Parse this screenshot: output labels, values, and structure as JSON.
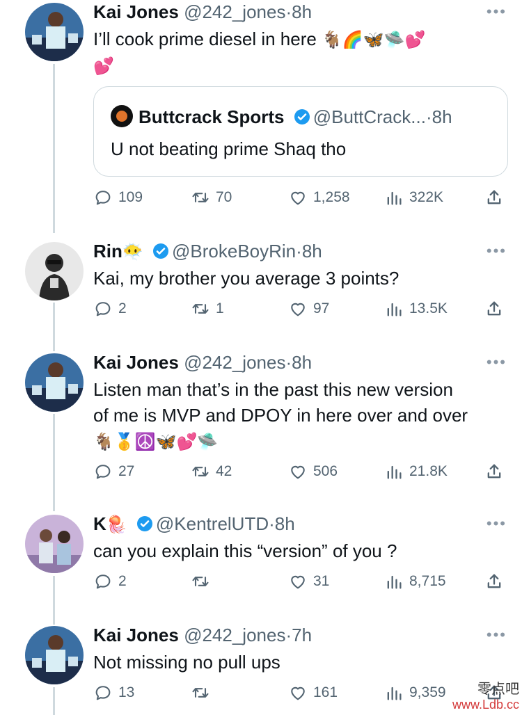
{
  "tweets": [
    {
      "name": "Kai Jones",
      "handle": "@242_jones",
      "dot": "·",
      "time": "8h",
      "line1": "I’ll cook prime diesel in here ",
      "emoji1": "🐐🌈🦋🛸💕",
      "emoji2": "💕",
      "quote": {
        "name": "Buttcrack Sports",
        "handle": "@ButtCrack...",
        "dot": "·",
        "time": "8h",
        "text": "U not beating prime Shaq tho"
      },
      "replies": "109",
      "retweets": "70",
      "likes": "1,258",
      "views": "322K"
    },
    {
      "name": "Rin",
      "name_emoji": "😶‍🌫️",
      "handle": "@BrokeBoyRin",
      "dot": "·",
      "time": "8h",
      "line1": "Kai, my brother you average 3 points?",
      "replies": "2",
      "retweets": "1",
      "likes": "97",
      "views": "13.5K"
    },
    {
      "name": "Kai Jones",
      "handle": "@242_jones",
      "dot": "·",
      "time": "8h",
      "line1": "Listen man that’s in the past this new version",
      "line2": "of me is MVP and DPOY in here over and over",
      "emoji1": "🐐🥇☮️🦋💕🛸",
      "replies": "27",
      "retweets": "42",
      "likes": "506",
      "views": "21.8K"
    },
    {
      "name": "K",
      "name_emoji": "🪼",
      "handle": "@KentrelUTD",
      "dot": "·",
      "time": "8h",
      "line1": "can you explain this “version” of you ?",
      "replies": "2",
      "retweets": "",
      "likes": "31",
      "views": "8,715"
    },
    {
      "name": "Kai Jones",
      "handle": "@242_jones",
      "dot": "·",
      "time": "7h",
      "line1": "Not missing no pull ups",
      "replies": "13",
      "retweets": "",
      "likes": "161",
      "views": "9,359"
    }
  ],
  "more_label": "•••",
  "watermark": {
    "line1": "零点吧",
    "line2": "www.Ldb.cc"
  },
  "colors": {
    "accent": "#1d9bf0",
    "muted": "#536471",
    "border": "#cfd9de"
  }
}
